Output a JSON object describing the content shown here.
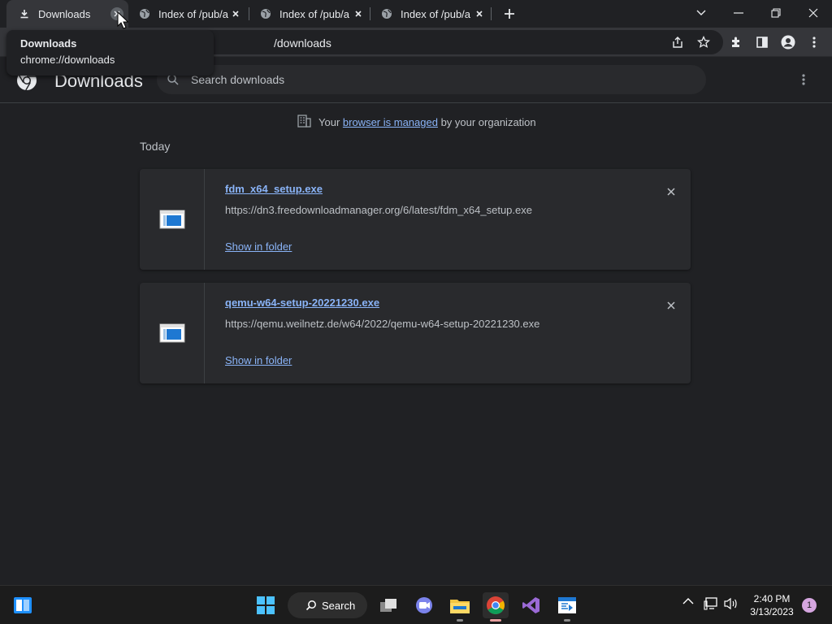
{
  "tabs": [
    {
      "title": "Downloads",
      "icon": "download-icon",
      "active": true
    },
    {
      "title": "Index of /pub/a",
      "icon": "globe-icon",
      "active": false
    },
    {
      "title": "Index of /pub/a",
      "icon": "globe-icon",
      "active": false
    },
    {
      "title": "Index of /pub/a",
      "icon": "globe-icon",
      "active": false
    }
  ],
  "tooltip": {
    "title": "Downloads",
    "url": "chrome://downloads"
  },
  "omnibox": {
    "text": "/downloads"
  },
  "header": {
    "title": "Downloads",
    "search_placeholder": "Search downloads"
  },
  "managed": {
    "prefix": "Your ",
    "link": "browser is managed",
    "suffix": " by your organization"
  },
  "section_date": "Today",
  "downloads": [
    {
      "filename": "fdm_x64_setup.exe",
      "url": "https://dn3.freedownloadmanager.org/6/latest/fdm_x64_setup.exe",
      "action": "Show in folder"
    },
    {
      "filename": "qemu-w64-setup-20221230.exe",
      "url": "https://qemu.weilnetz.de/w64/2022/qemu-w64-setup-20221230.exe",
      "action": "Show in folder"
    }
  ],
  "taskbar": {
    "search_label": "Search",
    "time": "2:40 PM",
    "date": "3/13/2023",
    "notifications": "1"
  },
  "colors": {
    "link": "#8ab4f8",
    "background": "#202124",
    "card": "#292a2d",
    "toolbar": "#35363a"
  }
}
